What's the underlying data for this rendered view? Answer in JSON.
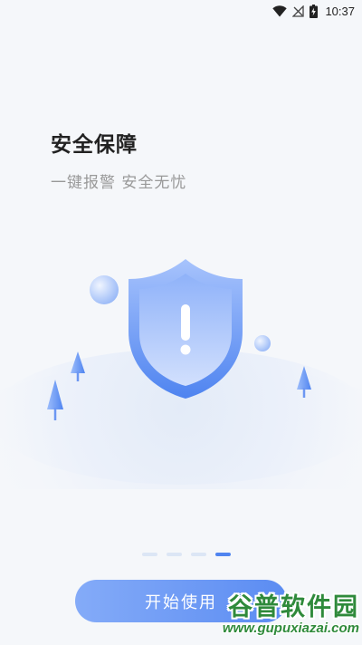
{
  "status_bar": {
    "time": "10:37",
    "icons": [
      "wifi-icon",
      "no-signal-icon",
      "battery-charging-icon"
    ]
  },
  "onboarding": {
    "title": "安全保障",
    "subtitle": "一键报警 安全无忧",
    "illustration_icon": "shield-exclamation-icon",
    "page_count": 4,
    "active_page": 4
  },
  "actions": {
    "start_label": "开始使用"
  },
  "watermark": {
    "logo_text": "谷普软件园",
    "url": "www.gupuxiazai.com"
  },
  "colors": {
    "background": "#f5f7fa",
    "accent": "#5b8cf2",
    "shield_light": "#a8c4fb",
    "dot_inactive": "#dce6f5",
    "watermark_green": "#2f8a3b"
  }
}
